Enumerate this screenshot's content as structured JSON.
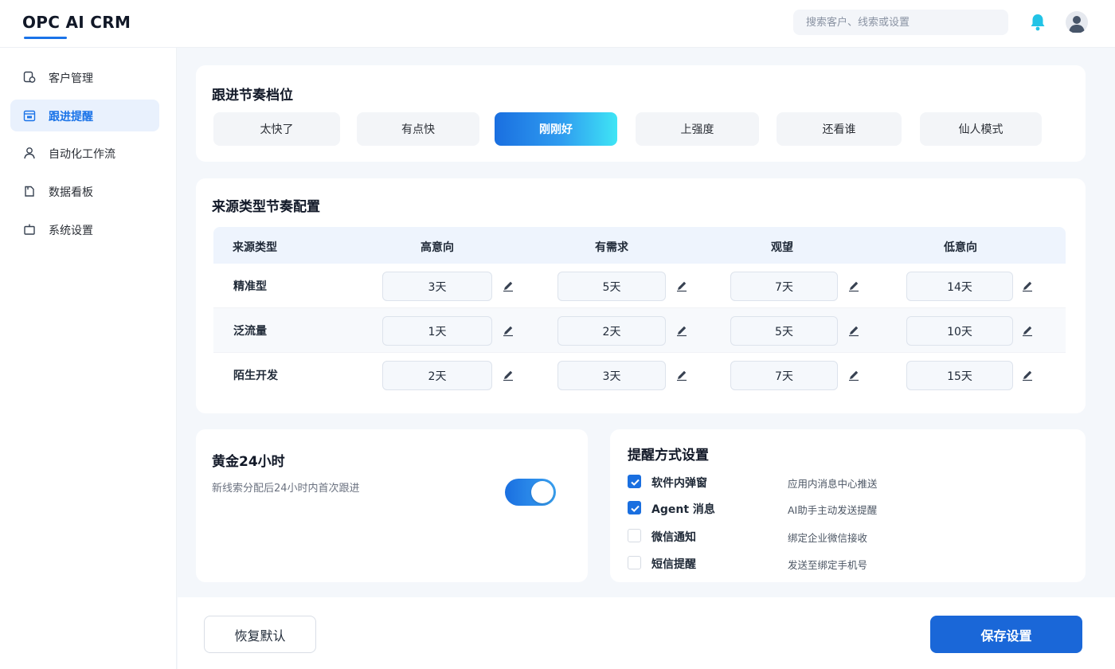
{
  "app": {
    "title": "OPC AI CRM"
  },
  "header": {
    "search_placeholder": "搜索客户、线索或设置",
    "bell_icon": "bell-icon",
    "avatar_icon": "user-avatar-icon",
    "accent": "#1a73e8",
    "bell_color": "#22c3e6"
  },
  "sidebar": {
    "items": [
      {
        "label": "客户管理",
        "icon": "customer-icon",
        "active": false
      },
      {
        "label": "跟进提醒",
        "icon": "calendar-reminder-icon",
        "active": true
      },
      {
        "label": "自动化工作流",
        "icon": "person-icon",
        "active": false
      },
      {
        "label": "数据看板",
        "icon": "dashboard-icon",
        "active": false
      },
      {
        "label": "系统设置",
        "icon": "settings-icon",
        "active": false
      }
    ]
  },
  "rhythm": {
    "title": "跟进节奏档位",
    "levels": [
      {
        "label": "太快了",
        "active": false
      },
      {
        "label": "有点快",
        "active": false
      },
      {
        "label": "刚刚好",
        "active": true
      },
      {
        "label": "上强度",
        "active": false
      },
      {
        "label": "还看谁",
        "active": false
      },
      {
        "label": "仙人模式",
        "active": false
      }
    ]
  },
  "source": {
    "title": "来源类型节奏配置",
    "headers": [
      "来源类型",
      "高意向",
      "有需求",
      "观望",
      "低意向"
    ],
    "rows": [
      {
        "label": "精准型",
        "values": [
          "3天",
          "5天",
          "7天",
          "14天"
        ]
      },
      {
        "label": "泛流量",
        "values": [
          "1天",
          "2天",
          "5天",
          "10天"
        ]
      },
      {
        "label": "陌生开发",
        "values": [
          "2天",
          "3天",
          "7天",
          "15天"
        ]
      }
    ]
  },
  "golden": {
    "title": "黄金24小时",
    "desc": "新线索分配后24小时内首次跟进",
    "enabled": true
  },
  "reminder": {
    "title": "提醒方式设置",
    "methods": [
      {
        "label": "软件内弹窗",
        "desc": "应用内消息中心推送",
        "checked": true
      },
      {
        "label": "Agent 消息",
        "desc": "AI助手主动发送提醒",
        "checked": true
      },
      {
        "label": "微信通知",
        "desc": "绑定企业微信接收",
        "checked": false
      },
      {
        "label": "短信提醒",
        "desc": "发送至绑定手机号",
        "checked": false
      }
    ]
  },
  "footer": {
    "reset_label": "恢复默认",
    "save_label": "保存设置"
  }
}
